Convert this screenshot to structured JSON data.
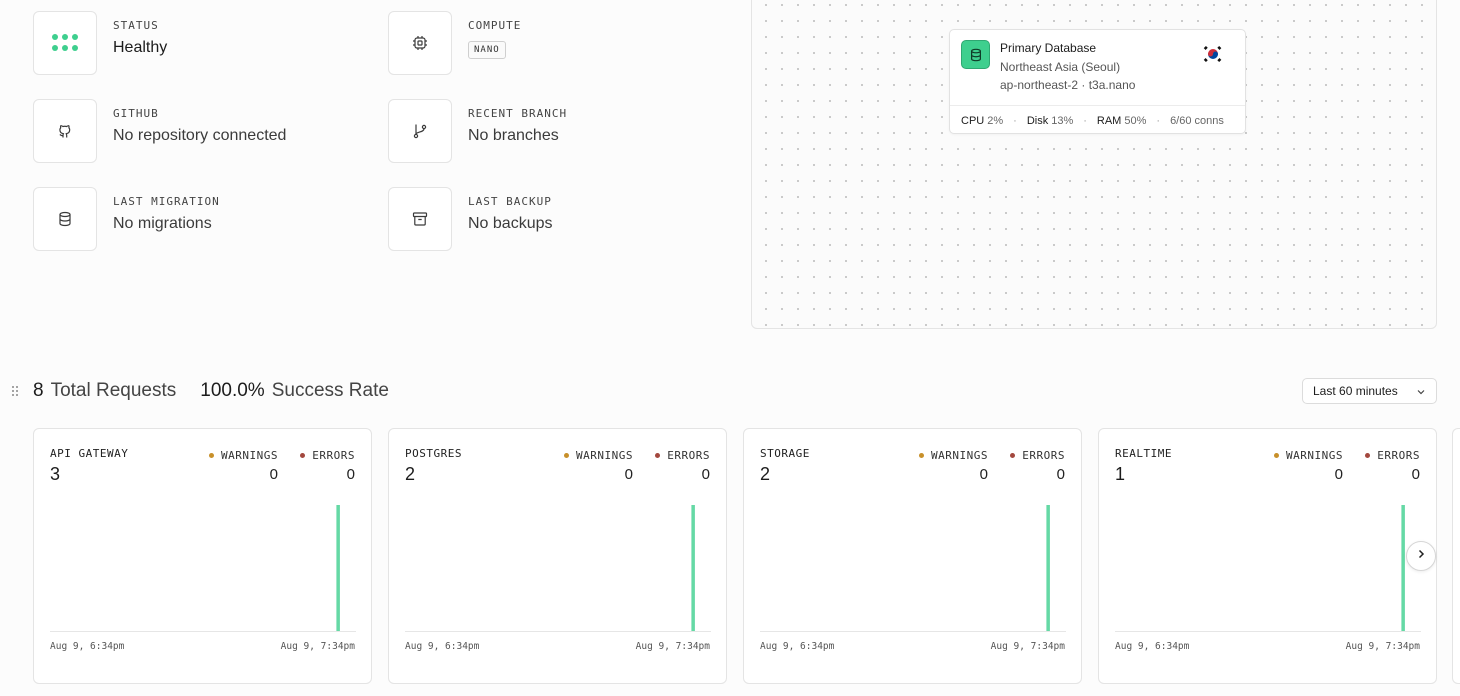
{
  "tiles": {
    "status": {
      "label": "STATUS",
      "value": "Healthy",
      "icon": "dots-icon"
    },
    "compute": {
      "label": "COMPUTE",
      "value": "NANO",
      "icon": "cpu-chip-icon"
    },
    "github": {
      "label": "GITHUB",
      "value": "No repository connected",
      "icon": "github-icon"
    },
    "recent_branch": {
      "label": "RECENT BRANCH",
      "value": "No branches",
      "icon": "git-branch-icon"
    },
    "last_migration": {
      "label": "LAST MIGRATION",
      "value": "No migrations",
      "icon": "database-icon"
    },
    "last_backup": {
      "label": "LAST BACKUP",
      "value": "No backups",
      "icon": "archive-icon"
    }
  },
  "database": {
    "name": "Primary Database",
    "region": "Northeast Asia (Seoul)",
    "spec": "ap-northeast-2 · t3a.nano",
    "flag": "south-korea-flag-icon",
    "stats": {
      "cpu_label": "CPU",
      "cpu_value": "2%",
      "disk_label": "Disk",
      "disk_value": "13%",
      "ram_label": "RAM",
      "ram_value": "50%",
      "conns": "6/60 conns"
    }
  },
  "summary": {
    "total_requests": "8",
    "total_requests_label": "Total Requests",
    "success_rate": "100.0%",
    "success_rate_label": "Success Rate"
  },
  "time_range": {
    "selected": "Last 60 minutes"
  },
  "legend": {
    "warnings": "WARNINGS",
    "errors": "ERRORS"
  },
  "colors": {
    "accent": "#3ecf8e",
    "warning": "#c8902a",
    "error": "#a3483e"
  },
  "services": [
    {
      "title": "API GATEWAY",
      "count": "3",
      "warnings": "0",
      "errors": "0",
      "start": "Aug 9, 6:34pm",
      "end": "Aug 9, 7:34pm"
    },
    {
      "title": "POSTGRES",
      "count": "2",
      "warnings": "0",
      "errors": "0",
      "start": "Aug 9, 6:34pm",
      "end": "Aug 9, 7:34pm"
    },
    {
      "title": "STORAGE",
      "count": "2",
      "warnings": "0",
      "errors": "0",
      "start": "Aug 9, 6:34pm",
      "end": "Aug 9, 7:34pm"
    },
    {
      "title": "REALTIME",
      "count": "1",
      "warnings": "0",
      "errors": "0",
      "start": "Aug 9, 6:34pm",
      "end": "Aug 9, 7:34pm"
    }
  ],
  "chart_data": [
    {
      "type": "bar",
      "series": [
        {
          "values": [
            0,
            0,
            0,
            0,
            0,
            0,
            0,
            0,
            0,
            0,
            0,
            0,
            0,
            0,
            0,
            0,
            0,
            0,
            0,
            0,
            0,
            0,
            0,
            0,
            0,
            0,
            0,
            0,
            0,
            0,
            0,
            0,
            0,
            0,
            0,
            0,
            0,
            0,
            0,
            0,
            0,
            0,
            0,
            0,
            0,
            0,
            0,
            0,
            0,
            0,
            0,
            0,
            0,
            0,
            0,
            0,
            3,
            0,
            0,
            0
          ]
        }
      ]
    },
    {
      "type": "bar",
      "series": [
        {
          "values": [
            0,
            0,
            0,
            0,
            0,
            0,
            0,
            0,
            0,
            0,
            0,
            0,
            0,
            0,
            0,
            0,
            0,
            0,
            0,
            0,
            0,
            0,
            0,
            0,
            0,
            0,
            0,
            0,
            0,
            0,
            0,
            0,
            0,
            0,
            0,
            0,
            0,
            0,
            0,
            0,
            0,
            0,
            0,
            0,
            0,
            0,
            0,
            0,
            0,
            0,
            0,
            0,
            0,
            0,
            0,
            0,
            2,
            0,
            0,
            0
          ]
        }
      ]
    },
    {
      "type": "bar",
      "series": [
        {
          "values": [
            0,
            0,
            0,
            0,
            0,
            0,
            0,
            0,
            0,
            0,
            0,
            0,
            0,
            0,
            0,
            0,
            0,
            0,
            0,
            0,
            0,
            0,
            0,
            0,
            0,
            0,
            0,
            0,
            0,
            0,
            0,
            0,
            0,
            0,
            0,
            0,
            0,
            0,
            0,
            0,
            0,
            0,
            0,
            0,
            0,
            0,
            0,
            0,
            0,
            0,
            0,
            0,
            0,
            0,
            0,
            0,
            2,
            0,
            0,
            0
          ]
        }
      ]
    },
    {
      "type": "bar",
      "series": [
        {
          "values": [
            0,
            0,
            0,
            0,
            0,
            0,
            0,
            0,
            0,
            0,
            0,
            0,
            0,
            0,
            0,
            0,
            0,
            0,
            0,
            0,
            0,
            0,
            0,
            0,
            0,
            0,
            0,
            0,
            0,
            0,
            0,
            0,
            0,
            0,
            0,
            0,
            0,
            0,
            0,
            0,
            0,
            0,
            0,
            0,
            0,
            0,
            0,
            0,
            0,
            0,
            0,
            0,
            0,
            0,
            0,
            0,
            1,
            0,
            0,
            0
          ]
        }
      ]
    }
  ]
}
